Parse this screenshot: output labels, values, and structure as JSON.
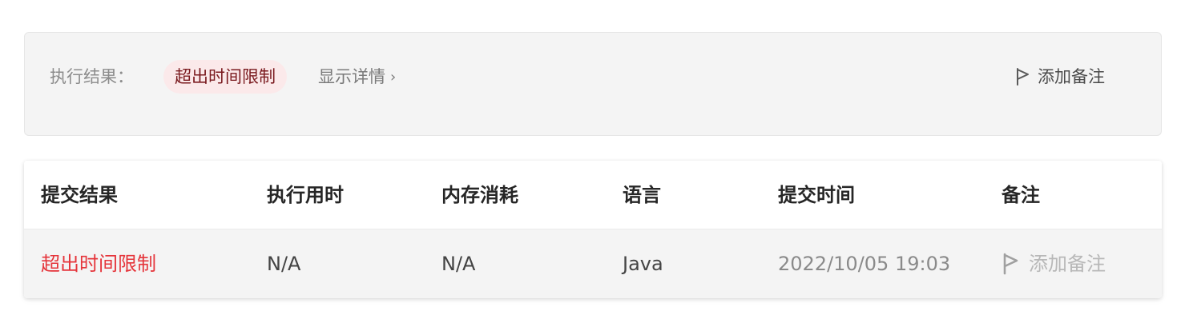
{
  "result_panel": {
    "label": "执行结果：",
    "status": "超出时间限制",
    "details_link": "显示详情",
    "details_chevron": "›",
    "add_note": "添加备注",
    "status_bg_color": "#fbe9ea",
    "status_text_color": "#7a1a1f"
  },
  "table": {
    "headers": [
      "提交结果",
      "执行用时",
      "内存消耗",
      "语言",
      "提交时间",
      "备注"
    ],
    "rows": [
      {
        "result": "超出时间限制",
        "runtime": "N/A",
        "memory": "N/A",
        "language": "Java",
        "submit_time": "2022/10/05 19:03",
        "note": "添加备注"
      }
    ],
    "result_color": "#e5343a"
  },
  "icons": {
    "flag": "flag-icon",
    "chevron": "chevron-right-icon"
  }
}
